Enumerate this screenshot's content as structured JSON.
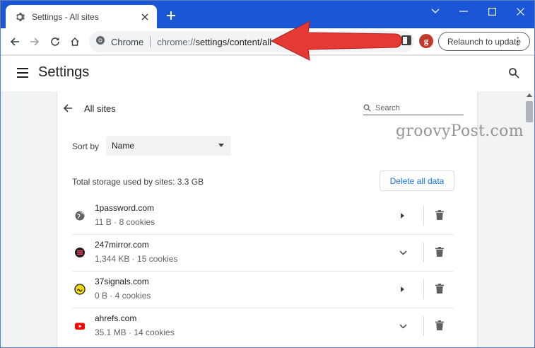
{
  "browser": {
    "tab_title": "Settings - All sites",
    "new_tab_icon": "plus-icon",
    "window_controls": [
      "chevron-down-icon",
      "minimize-icon",
      "maximize-icon",
      "close-icon"
    ],
    "omnibox": {
      "chip_label": "Chrome",
      "url_prefix": "chrome://",
      "url_path": "settings/content/all"
    },
    "avatar_letter": "g",
    "relaunch_label": "Relaunch to update",
    "accent_color": "#1a56d6"
  },
  "settings": {
    "title": "Settings"
  },
  "all_sites": {
    "title": "All sites",
    "search_placeholder": "Search",
    "sort_label": "Sort by",
    "sort_value": "Name",
    "storage_text": "Total storage used by sites: 3.3 GB",
    "delete_all_label": "Delete all data",
    "sites": [
      {
        "origin": "1password.com",
        "usage": "11 B · 8 cookies",
        "icon": "globe-icon",
        "expand": "chevron-right-icon"
      },
      {
        "origin": "247mirror.com",
        "usage": "1,344 KB · 15 cookies",
        "icon": "247mirror-favicon",
        "expand": "chevron-down-icon"
      },
      {
        "origin": "37signals.com",
        "usage": "0 B · 4 cookies",
        "icon": "37signals-favicon",
        "expand": "chevron-right-icon"
      },
      {
        "origin": "ahrefs.com",
        "usage": "35.1 MB · 14 cookies",
        "icon": "youtube-favicon",
        "expand": "chevron-down-icon"
      }
    ]
  },
  "watermark": "groovyPost.com",
  "annotation_color": "#e53935"
}
